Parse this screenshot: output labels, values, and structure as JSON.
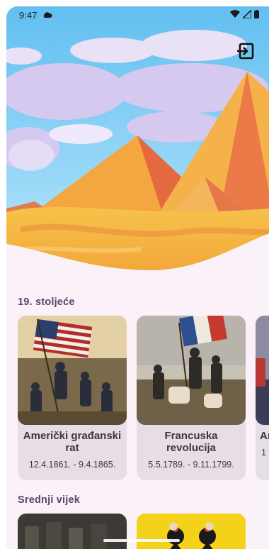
{
  "status_bar": {
    "time": "9:47",
    "icons": [
      "cloud-icon",
      "wifi-icon",
      "signal-icon",
      "battery-icon"
    ]
  },
  "header": {
    "exit_icon": "exit-to-app-icon"
  },
  "sections": [
    {
      "title": "19. stoljeće",
      "cards": [
        {
          "title": "Američki građanski rat",
          "dates": "12.4.1861. - 9.4.1865."
        },
        {
          "title": "Francuska revolucija",
          "dates": "5.5.1789. - 9.11.1799."
        },
        {
          "title": "Am",
          "dates": "1"
        }
      ]
    },
    {
      "title": "Srednji vijek",
      "cards": []
    }
  ],
  "colors": {
    "background": "#fbf1f9",
    "card": "#e6dde6",
    "section_title": "#5a4468",
    "text": "#3e3540"
  }
}
